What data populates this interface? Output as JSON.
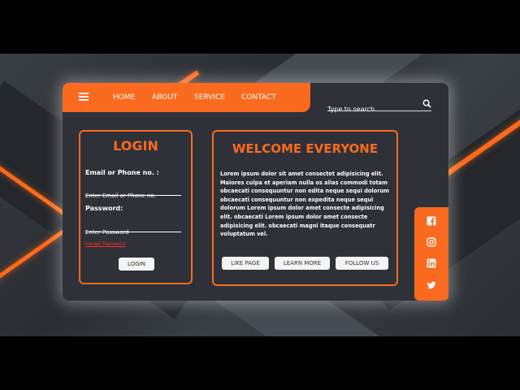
{
  "nav": {
    "items": [
      {
        "label": "HOME"
      },
      {
        "label": "ABOUT"
      },
      {
        "label": "SERVICE"
      },
      {
        "label": "CONTACT"
      }
    ]
  },
  "search": {
    "placeholder": "Type to search"
  },
  "login": {
    "title": "LOGIN",
    "email_label": "Email or Phone no. :",
    "email_placeholder": "Enter Email or Phone no.",
    "password_label": "Password:",
    "password_placeholder": "Enter Password",
    "forgot": "Forget Password",
    "button": "LOGIN"
  },
  "welcome": {
    "title": "WELCOME EVERYONE",
    "text": "Lorem ipsum dolor sit amet consectet adipisicing elit. Maiores culpa et aperiam nulla os alias commodi totam obcaecati consequuntur non edita neque sequi dolorum obcaecati consequuntur non expedita neque sequi dolorum Lorem ipsum dolor amet consecte adipisicing elit. obcaecati Lorem ipsum dolor amet consecte adipisicing elit. obcaecati magni itaque consequatr voluptatum vel.",
    "buttons": {
      "like": "LIKE PAGE",
      "learn": "LEARN MORE",
      "follow": "FOLLOW US"
    }
  },
  "social": {
    "icons": [
      "facebook-icon",
      "instagram-icon",
      "linkedin-icon",
      "twitter-icon"
    ]
  },
  "colors": {
    "accent": "#fa6a1f",
    "card": "#2e3138"
  }
}
